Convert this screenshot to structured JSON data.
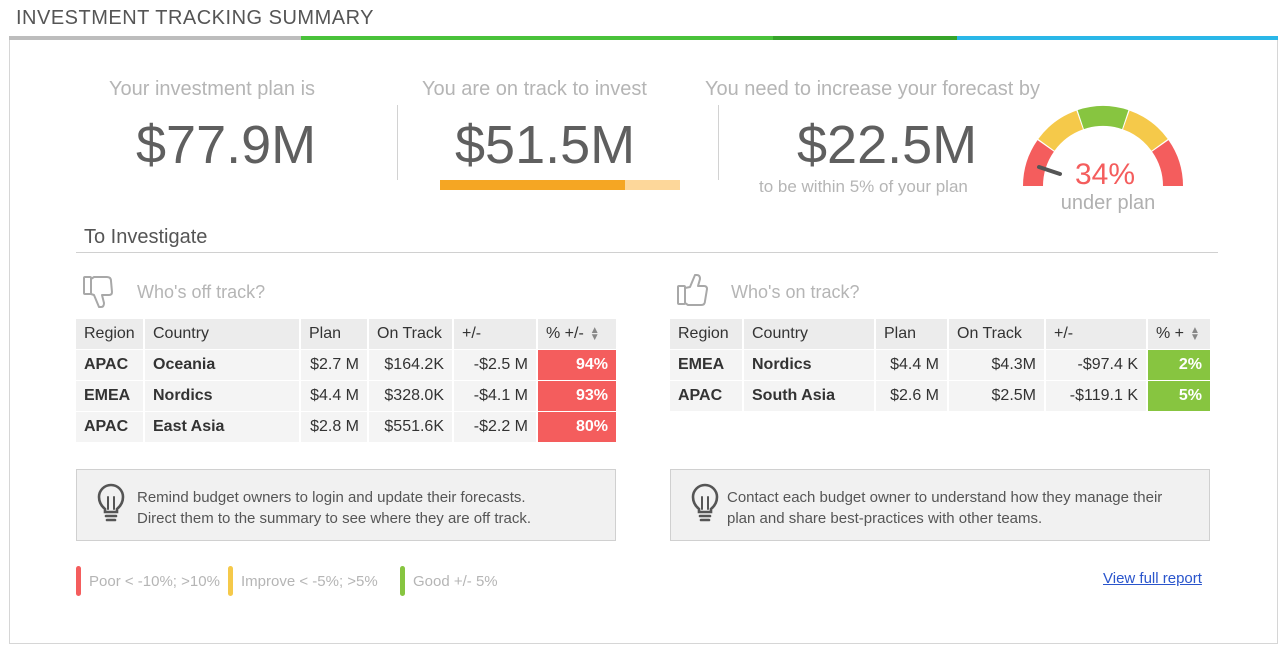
{
  "header": {
    "title": "INVESTMENT TRACKING SUMMARY",
    "bar_colors": [
      "#bdbdbd",
      "#49c23a",
      "#36a42a",
      "#2ab7e8"
    ]
  },
  "kpis": {
    "plan": {
      "label": "Your investment plan is",
      "value": "$77.9M"
    },
    "on_track": {
      "label": "You are on track to invest",
      "value": "$51.5M",
      "progress": 0.77,
      "progress_color": "#f5a623",
      "progress_bg": "#fdd79a"
    },
    "increase": {
      "label": "You need to increase your forecast by",
      "value": "$22.5M",
      "sub": "to be within 5% of your plan"
    }
  },
  "gauge": {
    "percent": "34%",
    "label": "under plan",
    "colors": {
      "poor": "#f45d5d",
      "improve": "#f5c94a",
      "good": "#87c540"
    }
  },
  "investigate": {
    "title": "To Investigate",
    "off_track": {
      "heading": "Who's off track?",
      "columns": [
        "Region",
        "Country",
        "Plan",
        "On Track",
        "+/-",
        "% +/-"
      ],
      "rows": [
        {
          "region": "APAC",
          "country": "Oceania",
          "plan": "$2.7 M",
          "on_track": "$164.2K",
          "diff": "-$2.5 M",
          "pct": "94%"
        },
        {
          "region": "EMEA",
          "country": "Nordics",
          "plan": "$4.4 M",
          "on_track": "$328.0K",
          "diff": "-$4.1 M",
          "pct": "93%"
        },
        {
          "region": "APAC",
          "country": "East Asia",
          "plan": "$2.8 M",
          "on_track": "$551.6K",
          "diff": "-$2.2 M",
          "pct": "80%"
        }
      ],
      "tip": [
        "Remind budget owners to login and update their forecasts.",
        "Direct them to the summary to see where they are off track."
      ]
    },
    "on_track": {
      "heading": "Who's on track?",
      "columns": [
        "Region",
        "Country",
        "Plan",
        "On Track",
        "+/-",
        "% +"
      ],
      "rows": [
        {
          "region": "EMEA",
          "country": "Nordics",
          "plan": "$4.4 M",
          "on_track": "$4.3M",
          "diff": "-$97.4 K",
          "pct": "2%"
        },
        {
          "region": "APAC",
          "country": "South Asia",
          "plan": "$2.6 M",
          "on_track": "$2.5M",
          "diff": "-$119.1 K",
          "pct": "5%"
        }
      ],
      "tip": [
        "Contact each budget owner to understand how they manage their",
        "plan and share best-practices with other teams."
      ]
    }
  },
  "legend": [
    {
      "label": "Poor < -10%; >10%",
      "color": "#f45d5d"
    },
    {
      "label": "Improve < -5%; >5%",
      "color": "#f5c94a"
    },
    {
      "label": "Good +/- 5%",
      "color": "#87c540"
    }
  ],
  "link": {
    "label": "View full report"
  }
}
